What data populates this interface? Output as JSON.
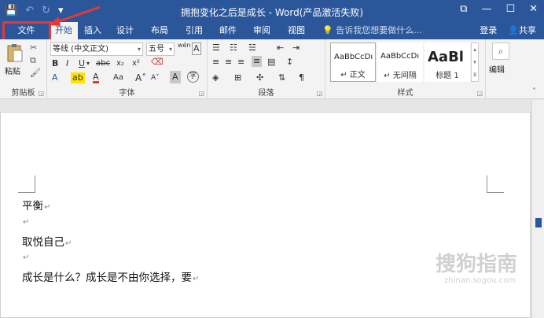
{
  "titlebar": {
    "quick_access": {
      "save_icon": "save-icon",
      "undo_icon": "undo-icon",
      "redo_icon": "redo-icon",
      "customize_icon": "customize-icon"
    },
    "title": "拥抱变化之后是成长 - Word(产品激活失败)"
  },
  "tabs": {
    "file": "文件",
    "home": "开始",
    "insert": "插入",
    "design": "设计",
    "layout": "布局",
    "references": "引用",
    "mailings": "邮件",
    "review": "审阅",
    "view": "视图",
    "tell_me": "告诉我您想要做什么...",
    "sign_in": "登录",
    "share": "共享"
  },
  "ribbon": {
    "clipboard": {
      "label": "剪贴板",
      "paste": "粘贴"
    },
    "font": {
      "label": "字体",
      "font_name": "等线 (中文正文)",
      "font_size": "五号",
      "bold": "B",
      "italic": "I",
      "underline": "U",
      "strike": "abc",
      "subscript": "x₂",
      "superscript": "x²",
      "phonetic": "wén",
      "char_border": "A"
    },
    "paragraph": {
      "label": "段落"
    },
    "styles": {
      "label": "样式",
      "items": [
        {
          "sample": "AaBbCcDı",
          "name": "↵ 正文"
        },
        {
          "sample": "AaBbCcDı",
          "name": "↵ 无间隔"
        },
        {
          "sample": "AaBl",
          "name": "标题 1"
        }
      ]
    },
    "editing": {
      "label": "编辑"
    }
  },
  "document": {
    "paragraphs": [
      "平衡",
      "",
      "取悦自己",
      "",
      "成长是什么？成长是不由你选择，要"
    ]
  },
  "watermark": {
    "text": "搜狗指南",
    "sub": "zhinan.sogou.com"
  },
  "colors": {
    "accent": "#2b579a",
    "highlight": "#e53935"
  }
}
